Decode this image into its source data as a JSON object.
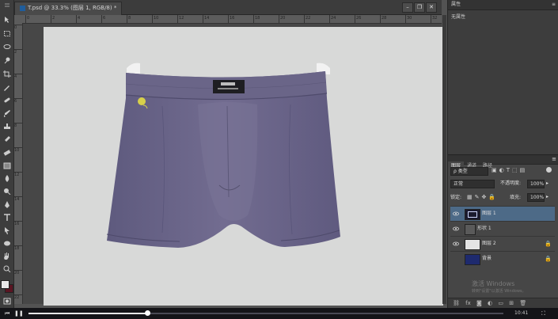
{
  "document": {
    "tab_title": "T.psd @ 33.3% (图层 1, RGB/8) *",
    "min_label": "–",
    "restore_label": "❐",
    "close_label": "✕"
  },
  "ruler": {
    "top_ticks": [
      "0",
      "2",
      "4",
      "6",
      "8",
      "10",
      "12",
      "14",
      "16",
      "18",
      "20",
      "22",
      "24",
      "26",
      "28",
      "30",
      "32"
    ],
    "left_ticks": [
      "0",
      "2",
      "4",
      "6",
      "8",
      "10",
      "12",
      "14",
      "16",
      "18",
      "20",
      "22"
    ]
  },
  "properties_panel": {
    "title": "属性",
    "content": "无属性"
  },
  "layers_panel": {
    "tabs": [
      "图层",
      "通道",
      "路径"
    ],
    "kind_filter": "ρ 类型",
    "blend_mode": "正常",
    "opacity_label": "不透明度:",
    "opacity_value": "100%",
    "lock_label": "锁定:",
    "fill_label": "填充:",
    "fill_value": "100%",
    "layers": [
      {
        "name": "图层 1",
        "selected": true,
        "lock": ""
      },
      {
        "name": "形状 1",
        "selected": false,
        "lock": ""
      },
      {
        "name": "图层 2",
        "selected": false,
        "lock": "🔒"
      },
      {
        "name": "背景",
        "selected": false,
        "lock": "🔒"
      }
    ]
  },
  "watermark": {
    "line1": "激活 Windows",
    "line2": "转到\"设置\"以激活 Windows。"
  },
  "video": {
    "progress": 0.25,
    "time": "10:41"
  },
  "colors": {
    "selected_layer": "#4d6a87",
    "boxer_fabric": "#6c6688",
    "canvas": "#d8d9d8"
  }
}
